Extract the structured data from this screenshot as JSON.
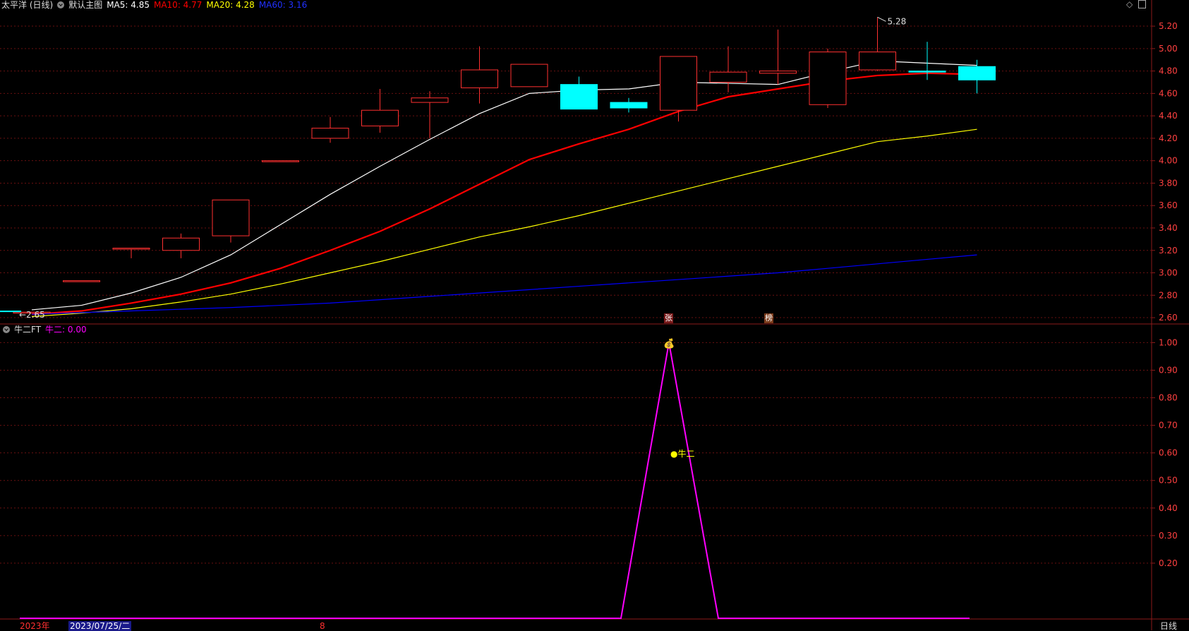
{
  "header": {
    "stock_title": "太平洋 (日线)",
    "main_chart_name": "默认主图",
    "ma5": "MA5: 4.85",
    "ma10": "MA10: 4.77",
    "ma20": "MA20: 4.28",
    "ma60": "MA60: 3.16"
  },
  "indicator_header": {
    "name": "牛二FT",
    "value": "牛二: 0.00"
  },
  "bottom": {
    "year": "2023年",
    "date": "2023/07/25/二",
    "month": "8",
    "period": "日线"
  },
  "markers": {
    "zhang": "张",
    "bang": "榜",
    "money_bag": "💰",
    "niuer_label": "牛二"
  },
  "colors": {
    "up": "#ff3030",
    "down": "#00ffff",
    "ma5": "#ffffff",
    "ma10": "#ff0000",
    "ma20": "#ffff00",
    "ma60": "#0000ff",
    "indicator": "#ff00ff",
    "grid": "#6a1010",
    "axis_text": "#ff4040"
  },
  "chart_data": [
    {
      "type": "candlestick",
      "ylim": [
        2.55,
        5.32
      ],
      "yticks": [
        "5.20",
        "5.00",
        "4.80",
        "4.60",
        "4.40",
        "4.20",
        "4.00",
        "3.80",
        "3.60",
        "3.40",
        "3.20",
        "3.00",
        "2.80",
        "2.60"
      ],
      "candles": [
        {
          "o": 2.65,
          "h": 2.65,
          "l": 2.65,
          "c": 2.65
        },
        {
          "o": 2.93,
          "h": 2.93,
          "l": 2.93,
          "c": 2.93
        },
        {
          "o": 3.22,
          "h": 3.22,
          "l": 3.13,
          "c": 3.22
        },
        {
          "o": 3.2,
          "h": 3.35,
          "l": 3.13,
          "c": 3.31
        },
        {
          "o": 3.33,
          "h": 3.65,
          "l": 3.27,
          "c": 3.65
        },
        {
          "o": 4.0,
          "h": 4.0,
          "l": 4.0,
          "c": 4.0
        },
        {
          "o": 4.2,
          "h": 4.39,
          "l": 4.16,
          "c": 4.29
        },
        {
          "o": 4.31,
          "h": 4.64,
          "l": 4.25,
          "c": 4.45
        },
        {
          "o": 4.52,
          "h": 4.62,
          "l": 4.2,
          "c": 4.56
        },
        {
          "o": 4.65,
          "h": 5.02,
          "l": 4.51,
          "c": 4.81
        },
        {
          "o": 4.66,
          "h": 4.86,
          "l": 4.66,
          "c": 4.86
        },
        {
          "o": 4.68,
          "h": 4.75,
          "l": 4.46,
          "c": 4.46
        },
        {
          "o": 4.52,
          "h": 4.56,
          "l": 4.43,
          "c": 4.47
        },
        {
          "o": 4.45,
          "h": 4.93,
          "l": 4.35,
          "c": 4.93
        },
        {
          "o": 4.7,
          "h": 5.02,
          "l": 4.61,
          "c": 4.79
        },
        {
          "o": 4.78,
          "h": 5.17,
          "l": 4.68,
          "c": 4.8
        },
        {
          "o": 4.5,
          "h": 5.0,
          "l": 4.47,
          "c": 4.97
        },
        {
          "o": 4.81,
          "h": 5.28,
          "l": 4.8,
          "c": 4.97
        },
        {
          "o": 4.8,
          "h": 5.06,
          "l": 4.72,
          "c": 4.79
        },
        {
          "o": 4.84,
          "h": 4.9,
          "l": 4.6,
          "c": 4.72
        }
      ],
      "series": [
        {
          "name": "MA5",
          "values": [
            2.67,
            2.71,
            2.82,
            2.96,
            3.16,
            3.43,
            3.7,
            3.95,
            4.19,
            4.42,
            4.6,
            4.63,
            4.64,
            4.7,
            4.69,
            4.68,
            4.79,
            4.89,
            4.87,
            4.85
          ]
        },
        {
          "name": "MA10",
          "values": [
            2.63,
            2.66,
            2.73,
            2.81,
            2.91,
            3.04,
            3.2,
            3.37,
            3.57,
            3.79,
            4.01,
            4.15,
            4.28,
            4.44,
            4.57,
            4.64,
            4.71,
            4.76,
            4.78,
            4.77
          ]
        },
        {
          "name": "MA20",
          "values": [
            2.61,
            2.64,
            2.68,
            2.74,
            2.81,
            2.9,
            3.0,
            3.1,
            3.21,
            3.32,
            3.41,
            3.51,
            3.62,
            3.73,
            3.84,
            3.95,
            4.06,
            4.17,
            4.22,
            4.28
          ]
        },
        {
          "name": "MA60",
          "values": [
            2.63,
            2.645,
            2.66,
            2.675,
            2.69,
            2.71,
            2.73,
            2.76,
            2.79,
            2.82,
            2.85,
            2.88,
            2.91,
            2.94,
            2.97,
            3.0,
            3.04,
            3.08,
            3.12,
            3.16
          ]
        }
      ],
      "high_label": "5.28",
      "low_label": "2.65"
    },
    {
      "type": "line",
      "ylim": [
        0.0,
        1.06
      ],
      "yticks": [
        "1.00",
        "0.90",
        "0.80",
        "0.70",
        "0.60",
        "0.50",
        "0.40",
        "0.30",
        "0.20"
      ],
      "series": [
        {
          "name": "牛二",
          "x": [
            0,
            12.2,
            13.2,
            14.2,
            19.7
          ],
          "values": [
            0,
            0,
            1,
            0,
            0
          ]
        }
      ]
    }
  ]
}
